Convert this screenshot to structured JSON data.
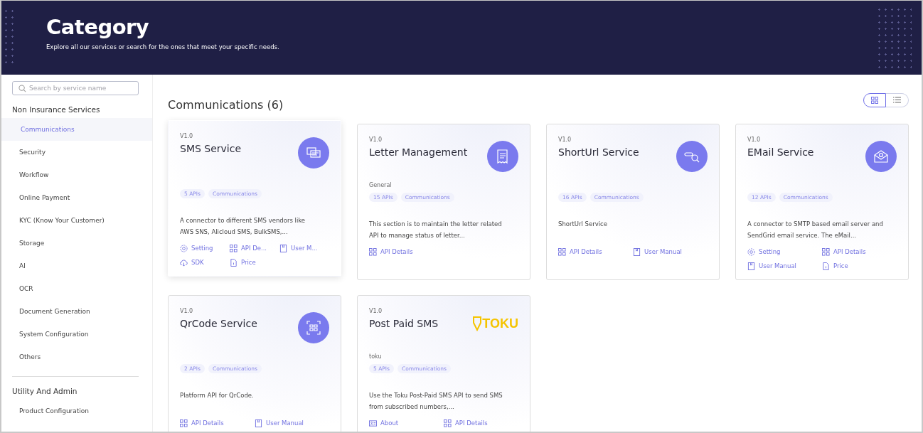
{
  "header": {
    "title": "Category",
    "subtitle": "Explore all our services or search for the ones that meet your specific needs."
  },
  "sidebar": {
    "search": {
      "placeholder": "Search by service name"
    },
    "groups": [
      {
        "title": "Non Insurance Services",
        "items": [
          {
            "label": "Communications",
            "selected": true
          },
          {
            "label": "Security",
            "selected": false
          },
          {
            "label": "Workflow",
            "selected": false
          },
          {
            "label": "Online Payment",
            "selected": false
          },
          {
            "label": "KYC (Know Your Customer)",
            "selected": false
          },
          {
            "label": "Storage",
            "selected": false
          },
          {
            "label": "AI",
            "selected": false
          },
          {
            "label": "OCR",
            "selected": false
          },
          {
            "label": "Document Generation",
            "selected": false
          },
          {
            "label": "System Configuration",
            "selected": false
          },
          {
            "label": "Others",
            "selected": false
          }
        ]
      },
      {
        "title": "Utility And Admin",
        "items": [
          {
            "label": "Product Configuration",
            "selected": false
          }
        ]
      }
    ]
  },
  "content": {
    "heading": "Communications (6)",
    "views": [
      {
        "kind": "grid",
        "selected": true
      },
      {
        "kind": "list",
        "selected": false
      }
    ],
    "cards": [
      {
        "version": "V1.0",
        "title": "SMS Service",
        "hovered": true,
        "kind": "chat",
        "tags": [
          "5 APIs",
          "Communications"
        ],
        "description": "A connector to different SMS vendors like AWS SNS, Alicloud SMS, BulkSMS,...",
        "links": [
          {
            "kind": "setting",
            "label": "Setting"
          },
          {
            "kind": "api",
            "label": "API De..."
          },
          {
            "kind": "manual",
            "label": "User M..."
          },
          {
            "kind": "sdk",
            "label": "SDK"
          },
          {
            "kind": "price",
            "label": "Price"
          }
        ]
      },
      {
        "version": "V1.0",
        "title": "Letter Management",
        "hovered": false,
        "kind": "receipt",
        "provider": "General",
        "tags": [
          "15 APIs",
          "Communications"
        ],
        "description": "This section is to maintain the letter related API to manage status of letter...",
        "links": [
          {
            "kind": "api",
            "label": "API Details"
          }
        ]
      },
      {
        "version": "V1.0",
        "title": "ShortUrl Service",
        "hovered": false,
        "kind": "link-search",
        "tags": [
          "16 APIs",
          "Communications"
        ],
        "description": "ShortUrl Service",
        "links": [
          {
            "kind": "api",
            "label": "API Details"
          },
          {
            "kind": "manual",
            "label": "User Manual"
          }
        ]
      },
      {
        "version": "V1.0",
        "title": "EMail Service",
        "hovered": false,
        "kind": "mail",
        "tags": [
          "12 APIs",
          "Communications"
        ],
        "description": "A connector to SMTP based email server and SendGrid email service. The eMail...",
        "links": [
          {
            "kind": "setting",
            "label": "Setting"
          },
          {
            "kind": "api",
            "label": "API Details"
          },
          {
            "kind": "manual",
            "label": "User Manual"
          },
          {
            "kind": "price",
            "label": "Price"
          }
        ]
      },
      {
        "version": "V1.0",
        "title": "QrCode Service",
        "hovered": false,
        "kind": "qr",
        "tags": [
          "2 APIs",
          "Communications"
        ],
        "description": "Platform API for QrCode.",
        "links": [
          {
            "kind": "api",
            "label": "API Details"
          },
          {
            "kind": "manual",
            "label": "User Manual"
          }
        ]
      },
      {
        "version": "V1.0",
        "title": "Post Paid SMS",
        "hovered": false,
        "kind": "brand",
        "logo_text": "TOKU",
        "provider": "toku",
        "tags": [
          "5 APIs",
          "Communications"
        ],
        "description": "Use the Toku Post-Paid SMS API to send SMS from subscribed numbers,...",
        "links": [
          {
            "kind": "about",
            "label": "About"
          },
          {
            "kind": "api",
            "label": "API Details"
          }
        ]
      }
    ]
  }
}
